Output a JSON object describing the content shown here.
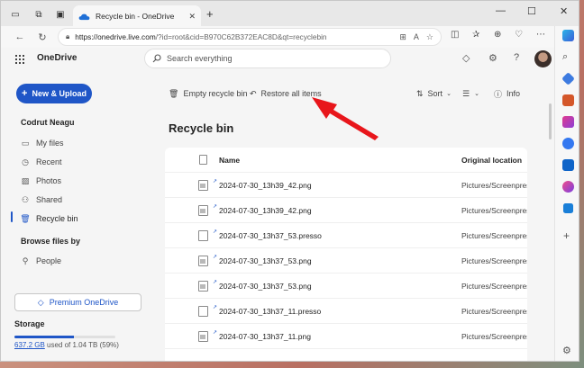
{
  "browser": {
    "tab_title": "Recycle bin - OneDrive",
    "tab_close": "✕",
    "new_tab": "+",
    "url_host": "https://onedrive.live.com",
    "url_path": "/?id=root&cid=B970C62B372EAC8D&qt=recyclebin",
    "window": {
      "minimize": "—",
      "maximize": "☐",
      "close": "✕"
    }
  },
  "app": {
    "brand": "OneDrive",
    "search_placeholder": "Search everything"
  },
  "leftnav": {
    "new_upload": "New & Upload",
    "user": "Codrut Neagu",
    "items": [
      {
        "label": "My files",
        "icon": "folder-icon"
      },
      {
        "label": "Recent",
        "icon": "clock-icon"
      },
      {
        "label": "Photos",
        "icon": "image-icon"
      },
      {
        "label": "Shared",
        "icon": "people-icon"
      },
      {
        "label": "Recycle bin",
        "icon": "trash-icon"
      }
    ],
    "browse_section": "Browse files by",
    "people": "People",
    "premium": "Premium OneDrive",
    "storage_title": "Storage",
    "storage_used": "637.2 GB",
    "storage_rest": " used of 1.04 TB (59%)",
    "storage_fraction": 0.59
  },
  "commandbar": {
    "empty": "Empty recycle bin",
    "restore": "Restore all items",
    "sort": "Sort",
    "info": "Info"
  },
  "page_title": "Recycle bin",
  "list": {
    "col_name": "Name",
    "col_location": "Original location",
    "rows": [
      {
        "name": "2024-07-30_13h39_42.png",
        "location": "Pictures/Screenpresso",
        "type": "image"
      },
      {
        "name": "2024-07-30_13h39_42.png",
        "location": "Pictures/Screenpresso",
        "type": "image"
      },
      {
        "name": "2024-07-30_13h37_53.presso",
        "location": "Pictures/Screenpresso",
        "type": "file"
      },
      {
        "name": "2024-07-30_13h37_53.png",
        "location": "Pictures/Screenpresso",
        "type": "image"
      },
      {
        "name": "2024-07-30_13h37_53.png",
        "location": "Pictures/Screenpresso",
        "type": "image"
      },
      {
        "name": "2024-07-30_13h37_11.presso",
        "location": "Pictures/Screenpresso",
        "type": "file"
      },
      {
        "name": "2024-07-30_13h37_11.png",
        "location": "Pictures/Screenpresso",
        "type": "image"
      }
    ]
  },
  "colors": {
    "accent": "#1f56c7",
    "annotation_arrow": "#e8161b"
  }
}
